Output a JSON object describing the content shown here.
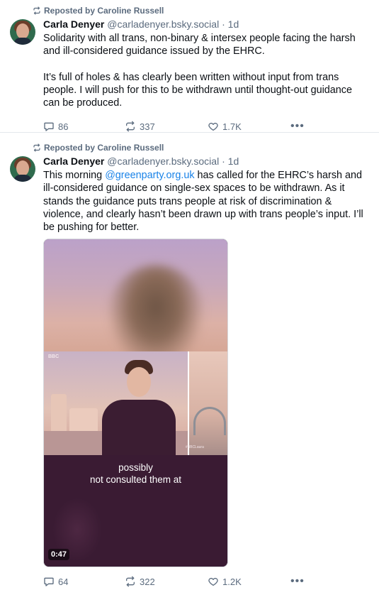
{
  "posts": [
    {
      "reposted_by": "Reposted by Caroline Russell",
      "author": {
        "name": "Carla Denyer",
        "handle": "@carladenyer.bsky.social",
        "time": "1d"
      },
      "text": {
        "p1": "Solidarity with all trans, non-binary & intersex people facing the harsh and ill-considered guidance issued by the EHRC.",
        "p2": "It’s full of holes & has clearly been written without input from trans people. I will push for this to be withdrawn until thought-out guidance can be produced."
      },
      "stats": {
        "replies": "86",
        "reposts": "337",
        "likes": "1.7K"
      },
      "more": "•••"
    },
    {
      "reposted_by": "Reposted by Caroline Russell",
      "author": {
        "name": "Carla Denyer",
        "handle": "@carladenyer.bsky.social",
        "time": "1d"
      },
      "text": {
        "before": "This morning ",
        "mention": "@greenparty.org.uk",
        "after": " has called for the EHRC’s harsh and ill-considered guidance on single-sex spaces to be withdrawn. As it stands the guidance puts trans people at risk of discrimination & violence, and clearly hasn’t been drawn up with trans people’s input. I’ll be pushing for better."
      },
      "video": {
        "caption_line1": "possibly",
        "caption_line2": "not consulted them at",
        "duration": "0:47",
        "logo": "BBC",
        "tag": "#BBCLaura"
      },
      "stats": {
        "replies": "64",
        "reposts": "322",
        "likes": "1.2K"
      },
      "more": "•••"
    }
  ],
  "colors": {
    "accent": "#1a83e8",
    "muted": "#5b6b7e",
    "text": "#0b0f14"
  }
}
